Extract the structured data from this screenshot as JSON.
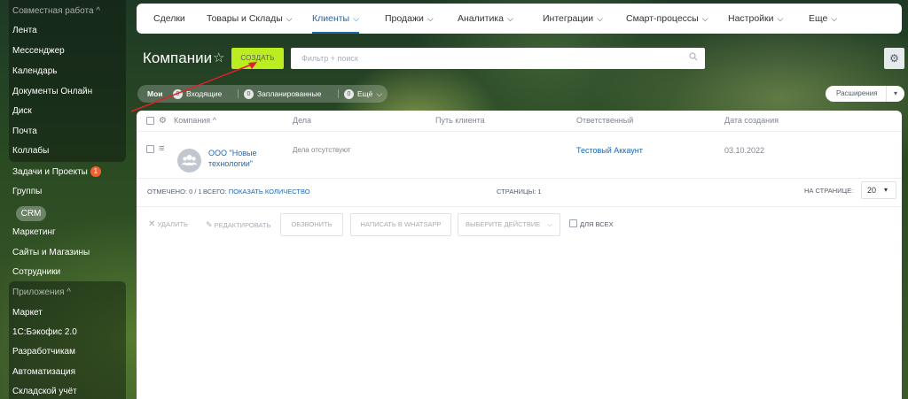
{
  "sidebar": {
    "group1_head": "Совместная работа ^",
    "items1": [
      "Лента",
      "Мессенджер",
      "Календарь",
      "Документы Онлайн",
      "Диск",
      "Почта",
      "Коллабы"
    ],
    "tasks": "Задачи и Проекты",
    "tasks_badge": "1",
    "groups": "Группы",
    "crm": "CRM",
    "items2": [
      "Маркетинг",
      "Сайты и Магазины",
      "Сотрудники"
    ],
    "group2_head": "Приложения ^",
    "items3": [
      "Маркет",
      "1С:Бэкофис 2.0",
      "Разработчикам",
      "Автоматизация",
      "Складской учёт"
    ]
  },
  "topnav": {
    "items": [
      "Сделки",
      "Товары и Склады",
      "Клиенты",
      "Продажи",
      "Аналитика",
      "Интеграции",
      "Смарт-процессы",
      "Настройки",
      "Еще"
    ],
    "active": "Клиенты"
  },
  "title": {
    "text": "Компании",
    "create_label": "СОЗДАТЬ",
    "search_placeholder": "Фильтр + поиск"
  },
  "counters": {
    "mine": "Мои",
    "incoming_count": "0",
    "incoming": "Входящие",
    "planned_count": "0",
    "planned": "Запланированные",
    "more_count": "0",
    "more": "Ещё"
  },
  "extensions_label": "Расширения",
  "table": {
    "columns": [
      "Компания ^",
      "Дела",
      "Путь клиента",
      "Ответственный",
      "Дата создания"
    ],
    "rows": [
      {
        "company_line1": "ООО \"Новые",
        "company_line2": "технологии\"",
        "deals": "Дела отсутствуют",
        "responsible": "Тестовый Аккаунт",
        "created": "03.10.2022"
      }
    ]
  },
  "footer": {
    "marked": "ОТМЕЧЕНО: 0 / 1",
    "total_label": "ВСЕГО:",
    "show_count": "ПОКАЗАТЬ КОЛИЧЕСТВО",
    "pages": "СТРАНИЦЫ: 1",
    "per_page_label": "НА СТРАНИЦЕ:",
    "per_page_value": "20"
  },
  "actions": {
    "delete": "УДАЛИТЬ",
    "edit": "РЕДАКТИРОВАТЬ",
    "call": "ОБЗВОНИТЬ",
    "whatsapp": "НАПИСАТЬ В WHATSAPP",
    "choose": "ВЫБЕРИТЕ ДЕЙСТВИЕ",
    "for_all": "ДЛЯ ВСЕХ"
  },
  "colors": {
    "accent_blue": "#2067b0",
    "create_green": "#bbed21",
    "badge_orange": "#f0612f",
    "annotation_red": "#e0202a"
  }
}
